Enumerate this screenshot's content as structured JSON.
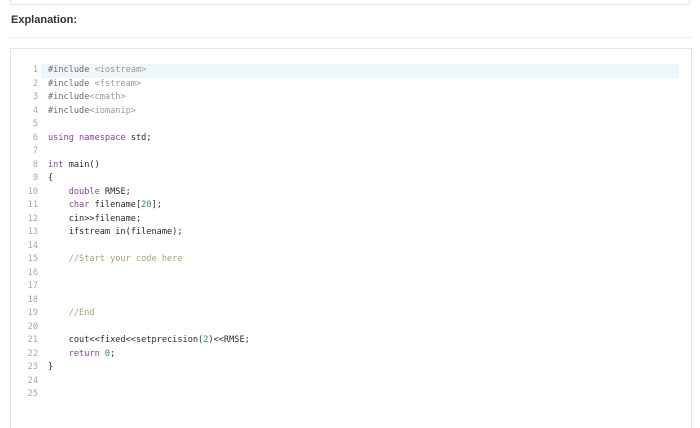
{
  "page": {
    "heading": "Explanation:"
  },
  "code": {
    "highlighted_line": 1,
    "lines": [
      {
        "n": "1",
        "tokens": [
          {
            "t": "#include ",
            "c": "pre"
          },
          {
            "t": "<iostream>",
            "c": "str"
          }
        ]
      },
      {
        "n": "2",
        "tokens": [
          {
            "t": "#include ",
            "c": "pre"
          },
          {
            "t": "<fstream>",
            "c": "str"
          }
        ]
      },
      {
        "n": "3",
        "tokens": [
          {
            "t": "#include",
            "c": "pre"
          },
          {
            "t": "<cmath>",
            "c": "str"
          }
        ]
      },
      {
        "n": "4",
        "tokens": [
          {
            "t": "#include",
            "c": "pre"
          },
          {
            "t": "<iomanip>",
            "c": "str"
          }
        ]
      },
      {
        "n": "5",
        "tokens": []
      },
      {
        "n": "6",
        "tokens": [
          {
            "t": "using namespace ",
            "c": "kw"
          },
          {
            "t": "std;",
            "c": "plain"
          }
        ]
      },
      {
        "n": "7",
        "tokens": []
      },
      {
        "n": "8",
        "tokens": [
          {
            "t": "int ",
            "c": "type"
          },
          {
            "t": "main()",
            "c": "plain"
          }
        ]
      },
      {
        "n": "9",
        "tokens": [
          {
            "t": "{",
            "c": "plain"
          }
        ]
      },
      {
        "n": "10",
        "tokens": [
          {
            "t": "    double ",
            "c": "type"
          },
          {
            "t": "RMSE;",
            "c": "plain"
          }
        ]
      },
      {
        "n": "11",
        "tokens": [
          {
            "t": "    char ",
            "c": "type"
          },
          {
            "t": "filename[",
            "c": "plain"
          },
          {
            "t": "20",
            "c": "num"
          },
          {
            "t": "];",
            "c": "plain"
          }
        ]
      },
      {
        "n": "12",
        "tokens": [
          {
            "t": "    cin>>filename;",
            "c": "plain"
          }
        ]
      },
      {
        "n": "13",
        "tokens": [
          {
            "t": "    ifstream in(filename);",
            "c": "plain"
          }
        ]
      },
      {
        "n": "14",
        "tokens": []
      },
      {
        "n": "15",
        "tokens": [
          {
            "t": "    //Start your code here",
            "c": "com"
          }
        ]
      },
      {
        "n": "16",
        "tokens": []
      },
      {
        "n": "17",
        "tokens": []
      },
      {
        "n": "18",
        "tokens": []
      },
      {
        "n": "19",
        "tokens": [
          {
            "t": "    //End",
            "c": "com"
          }
        ]
      },
      {
        "n": "20",
        "tokens": []
      },
      {
        "n": "21",
        "tokens": [
          {
            "t": "    cout<<fixed<<setprecision(",
            "c": "plain"
          },
          {
            "t": "2",
            "c": "num"
          },
          {
            "t": ")<<RMSE;",
            "c": "plain"
          }
        ]
      },
      {
        "n": "22",
        "tokens": [
          {
            "t": "    return ",
            "c": "kw"
          },
          {
            "t": "0",
            "c": "num"
          },
          {
            "t": ";",
            "c": "plain"
          }
        ]
      },
      {
        "n": "23",
        "tokens": [
          {
            "t": "}",
            "c": "plain"
          }
        ]
      },
      {
        "n": "24",
        "tokens": []
      },
      {
        "n": "25",
        "tokens": []
      }
    ]
  }
}
